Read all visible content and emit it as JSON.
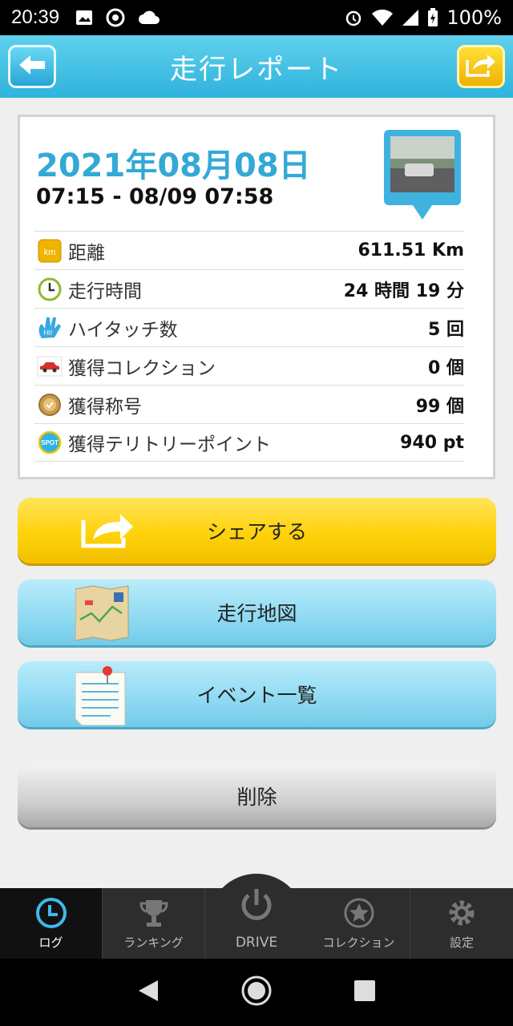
{
  "status_bar": {
    "time": "20:39",
    "battery": "100%"
  },
  "header": {
    "title": "走行レポート"
  },
  "report": {
    "date": "2021年08月08日",
    "time_range": "07:15 - 08/09 07:58",
    "stats": [
      {
        "icon": "km-icon",
        "label": "距離",
        "value": "611.51 Km"
      },
      {
        "icon": "clock-icon",
        "label": "走行時間",
        "value": "24 時間 19 分"
      },
      {
        "icon": "hi-five-icon",
        "label": "ハイタッチ数",
        "value": "5 回"
      },
      {
        "icon": "car-icon",
        "label": "獲得コレクション",
        "value": "0 個"
      },
      {
        "icon": "medal-icon",
        "label": "獲得称号",
        "value": "99 個"
      },
      {
        "icon": "spot-icon",
        "label": "獲得テリトリーポイント",
        "value": "940 pt"
      }
    ],
    "icon_text": {
      "km": "km",
      "hi": "Hi!",
      "spot": "SPOT"
    }
  },
  "buttons": {
    "share": "シェアする",
    "map": "走行地図",
    "events": "イベント一覧",
    "delete": "削除"
  },
  "tabs": {
    "log": "ログ",
    "ranking": "ランキング",
    "drive": "DRIVE",
    "collection": "コレクション",
    "settings": "設定"
  },
  "colors": {
    "header": "#2fb3dd",
    "date": "#33a9d6",
    "share": "#ffd20a",
    "map": "#8ed9f2",
    "delete": "#cfcfcf"
  }
}
